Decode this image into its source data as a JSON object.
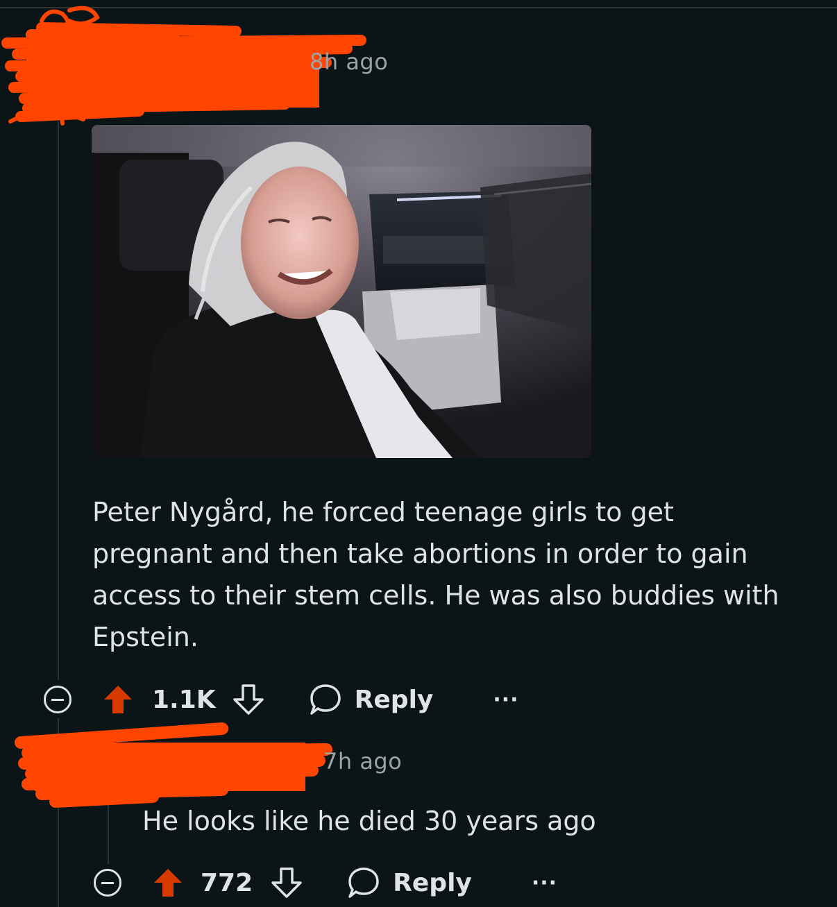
{
  "comments": [
    {
      "author": "",
      "time": "8h ago",
      "image_alt": "Photo of elderly man with long white hair smiling in back seat of a vehicle",
      "body_lines": [
        "Peter Nygård, he forced teenage girls to get",
        "pregnant and then take abortions in order to gain",
        "access to their stem cells. He was also buddies with",
        "Epstein."
      ],
      "score": "1.1K",
      "reply_label": "Reply",
      "more_label": "···"
    },
    {
      "author": "",
      "time": "7h ago",
      "body_lines": [
        "He looks like he died 30 years ago"
      ],
      "score": "772",
      "reply_label": "Reply",
      "more_label": "···"
    }
  ],
  "colors": {
    "background": "#0b1416",
    "upvote": "#d93a00",
    "redaction": "#ff4500",
    "text": "#dfe3e6",
    "meta": "#9aa3a8"
  },
  "icons": [
    "collapse-icon",
    "upvote-icon",
    "downvote-icon",
    "comment-icon",
    "more-icon"
  ]
}
